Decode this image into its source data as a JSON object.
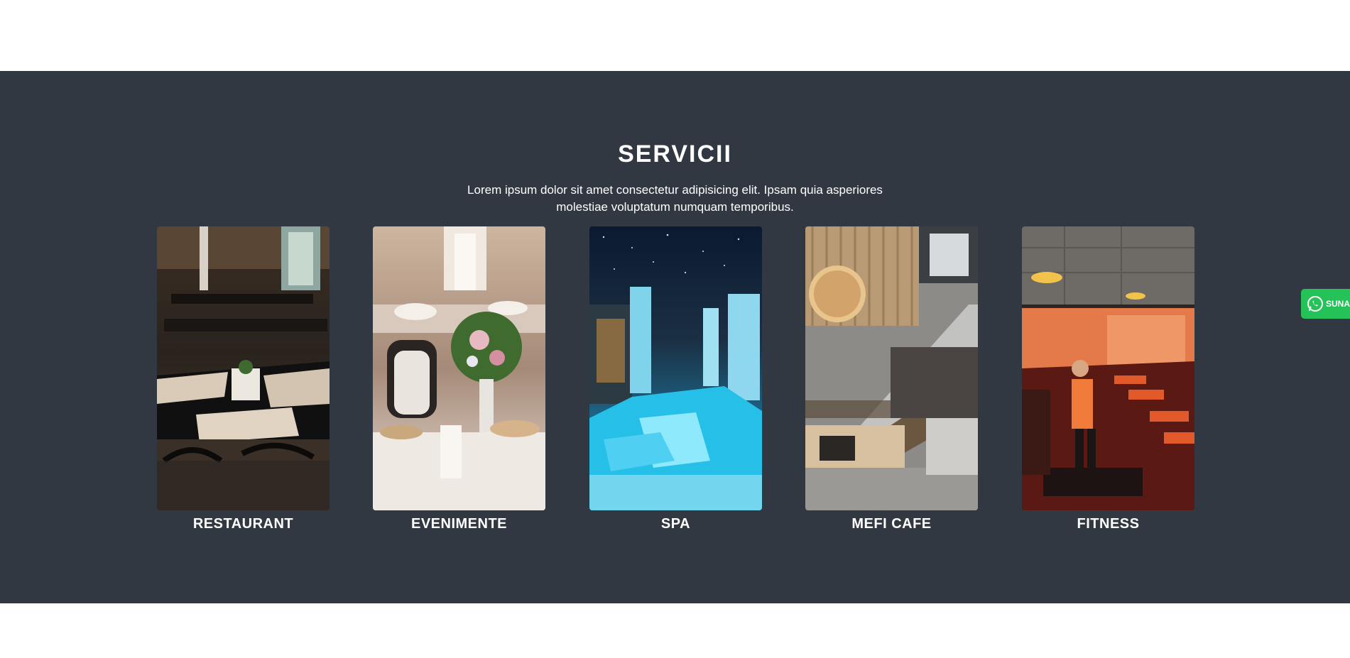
{
  "services": {
    "title": "SERVICII",
    "subtitle": "Lorem ipsum dolor sit amet consectetur adipisicing elit. Ipsam quia asperiores molestiae voluptatum numquam temporibus.",
    "background": "#313842",
    "items": [
      {
        "label": "RESTAURANT",
        "image_icon": "restaurant-photo"
      },
      {
        "label": "EVENIMENTE",
        "image_icon": "events-photo"
      },
      {
        "label": "SPA",
        "image_icon": "spa-photo"
      },
      {
        "label": "MEFI CAFE",
        "image_icon": "cafe-photo"
      },
      {
        "label": "FITNESS",
        "image_icon": "fitness-photo"
      }
    ]
  },
  "whatsapp": {
    "label": "SUNA",
    "icon": "whatsapp-icon",
    "color": "#25c25a"
  }
}
